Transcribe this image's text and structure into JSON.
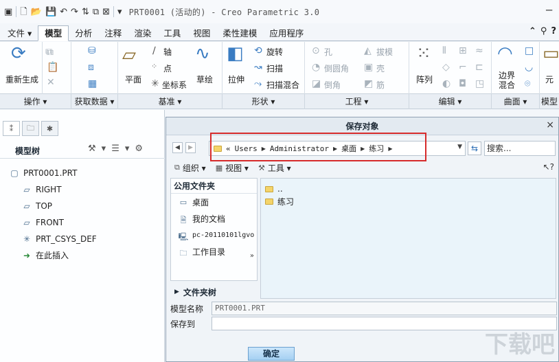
{
  "titlebar": {
    "title": "PRT0001 (活动的) - Creo Parametric 3.0",
    "minimize": "─"
  },
  "tabs": [
    {
      "label": "文件",
      "suffix": " ▾"
    },
    {
      "label": "模型"
    },
    {
      "label": "分析"
    },
    {
      "label": "注释"
    },
    {
      "label": "渲染"
    },
    {
      "label": "工具"
    },
    {
      "label": "视图"
    },
    {
      "label": "柔性建模"
    },
    {
      "label": "应用程序"
    }
  ],
  "ribbon": {
    "regen": "重新生成",
    "plane": "平面",
    "axis": "轴",
    "point": "点",
    "csys": "坐标系",
    "sketch": "草绘",
    "extrude": "拉伸",
    "revolve": "旋转",
    "sweep": "扫描",
    "sweep_blend": "扫描混合",
    "hole": "孔",
    "round": "倒圆角",
    "chamfer": "倒角",
    "draft": "拔模",
    "shell": "壳",
    "rib": "筋",
    "pattern": "阵列",
    "boundary1": "边界",
    "boundary2": "混合",
    "model_extra": "元"
  },
  "groups": [
    {
      "label": "操作 ▾"
    },
    {
      "label": "获取数据 ▾"
    },
    {
      "label": "基准 ▾"
    },
    {
      "label": "形状 ▾"
    },
    {
      "label": "工程 ▾"
    },
    {
      "label": "编辑 ▾"
    },
    {
      "label": "曲面 ▾"
    },
    {
      "label": "模型"
    }
  ],
  "tree": {
    "title": "模型树",
    "items": [
      {
        "label": "PRT0001.PRT"
      },
      {
        "label": "RIGHT"
      },
      {
        "label": "TOP"
      },
      {
        "label": "FRONT"
      },
      {
        "label": "PRT_CSYS_DEF"
      },
      {
        "label": "在此插入"
      }
    ]
  },
  "dialog": {
    "title": "保存对象",
    "close": "×",
    "path": [
      "Users",
      "Administrator",
      "桌面",
      "练习"
    ],
    "path_prefix": "«",
    "search_placeholder": "搜索...",
    "toolbar": {
      "organize": "组织 ▾",
      "view": "视图 ▾",
      "tools": "工具 ▾",
      "help": "?"
    },
    "favorites": {
      "title": "公用文件夹",
      "items": [
        {
          "label": "桌面"
        },
        {
          "label": "我的文档"
        },
        {
          "label": "pc-20110101lgvo"
        },
        {
          "label": "工作目录"
        }
      ]
    },
    "folder_tree_label": "文件夹树",
    "files": [
      {
        "label": ".."
      },
      {
        "label": "练习"
      }
    ],
    "model_name_label": "模型名称",
    "model_name_value": "PRT0001.PRT",
    "save_to_label": "保存到",
    "save_to_value": "",
    "ok_label": "确定"
  },
  "watermark": "下载吧"
}
